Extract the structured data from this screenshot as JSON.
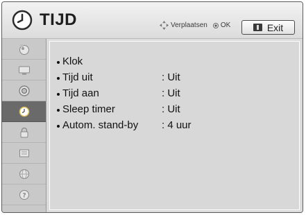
{
  "header": {
    "title": "TIJD",
    "nav_hint": "Verplaatsen",
    "ok_hint": "OK",
    "exit_label": "Exit"
  },
  "sidebar": {
    "items": [
      {
        "icon": "picture-icon",
        "selected": false
      },
      {
        "icon": "tv-icon",
        "selected": false
      },
      {
        "icon": "audio-icon",
        "selected": false
      },
      {
        "icon": "time-icon",
        "selected": true
      },
      {
        "icon": "lock-icon",
        "selected": false
      },
      {
        "icon": "option-icon",
        "selected": false
      },
      {
        "icon": "network-icon",
        "selected": false
      },
      {
        "icon": "support-icon",
        "selected": false
      }
    ]
  },
  "menu": {
    "items": [
      {
        "label": "Klok",
        "value": ""
      },
      {
        "label": "Tijd uit",
        "value": ": Uit"
      },
      {
        "label": "Tijd aan",
        "value": ": Uit"
      },
      {
        "label": "Sleep timer",
        "value": ": Uit"
      },
      {
        "label": "Autom. stand-by",
        "value": ": 4 uur"
      }
    ]
  }
}
